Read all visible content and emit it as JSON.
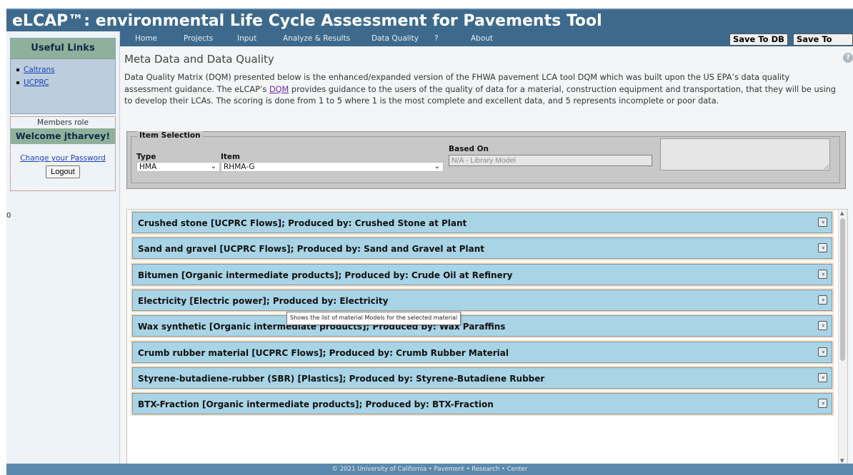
{
  "app": {
    "title": "eLCAP™: environmental Life Cycle Assessment for Pavements Tool"
  },
  "sidebar": {
    "links_heading": "Useful Links",
    "links": [
      "Caltrans",
      "UCPRC"
    ],
    "members_role": "Members role",
    "welcome": "Welcome jtharvey!",
    "change_password": "Change your Password",
    "logout": "Logout",
    "stray_text": "0"
  },
  "nav": {
    "items": [
      "Home",
      "Projects",
      "Input",
      "Analyze & Results",
      "Data Quality",
      "?",
      "About"
    ],
    "save_db": "Save To DB",
    "save_file": "Save To File"
  },
  "page": {
    "title": "Meta Data and Data Quality",
    "help": "?",
    "desc_part1": "Data Quality Matrix (DQM) presented below is the enhanced/expanded version of the FHWA pavement LCA tool DQM which was built upon the US EPA’s data quality assessment guidance. The eLCAP’s ",
    "desc_link": "DQM",
    "desc_part2": " provides guidance to the users of the quality of data for a material, construction equipment and transportation, that they will be using to develop their LCAs. The scoring is done from 1 to 5 where 1 is the most complete and excellent data, and 5 represents incomplete or poor data."
  },
  "item_selection": {
    "legend": "Item Selection",
    "type_label": "Type",
    "type_value": "HMA",
    "item_label": "Item",
    "item_value": "RHMA-G",
    "based_on_label": "Based On",
    "based_on_placeholder": "N/A - Library Model",
    "notes_value": ""
  },
  "materials": [
    "Crushed stone [UCPRC Flows]; Produced by: Crushed Stone at Plant",
    "Sand and gravel [UCPRC Flows]; Produced by: Sand and Gravel at Plant",
    "Bitumen [Organic intermediate products]; Produced by: Crude Oil at Refinery",
    "Electricity [Electric power]; Produced by: Electricity",
    "Wax synthetic [Organic intermediate products]; Produced by: Wax Paraffins",
    "Crumb rubber material [UCPRC Flows]; Produced by: Crumb Rubber Material",
    "Styrene-butadiene-rubber (SBR) [Plastics]; Produced by: Styrene-Butadiene Rubber",
    "BTX-Fraction [Organic intermediate products]; Produced by: BTX-Fraction"
  ],
  "tooltip": "Shows the list of material Models for the selected material",
  "footer": "© 2021 University of California • Pavement • Research • Center",
  "colors": {
    "header": "#3d6a8c",
    "accordion": "#a8d4e6",
    "accordion_border": "#f6dcc2",
    "footer": "#5b89ad"
  }
}
